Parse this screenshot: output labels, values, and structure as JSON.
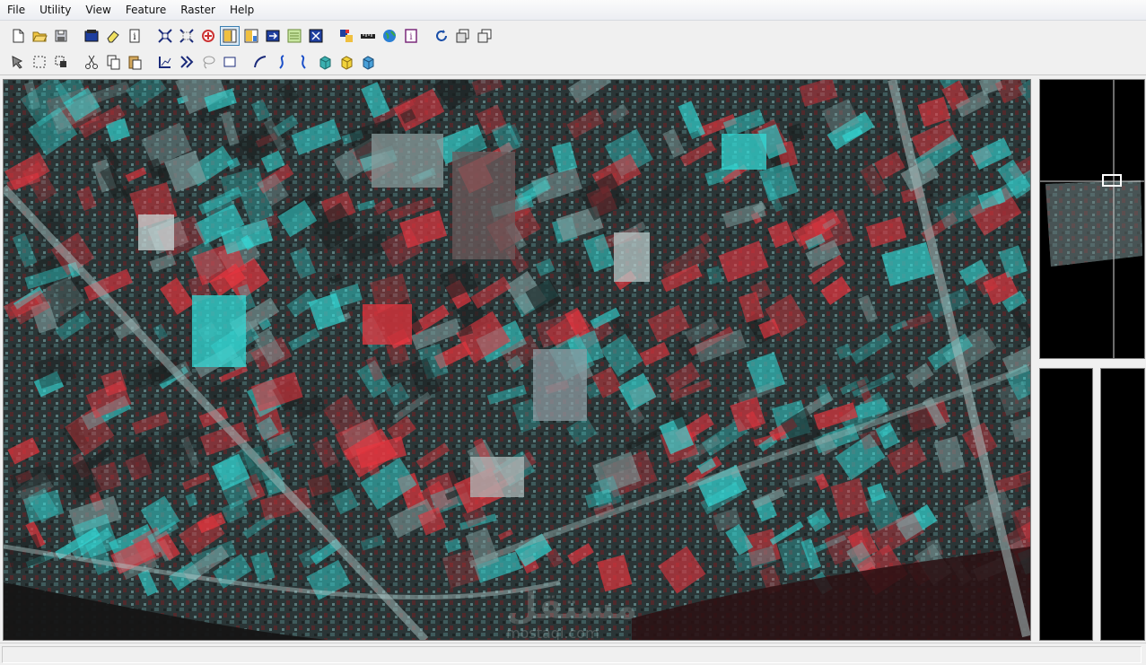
{
  "menu": [
    "File",
    "Utility",
    "View",
    "Feature",
    "Raster",
    "Help"
  ],
  "toolbar_primary": [
    {
      "icon": "new-file-icon"
    },
    {
      "icon": "open-folder-icon"
    },
    {
      "icon": "save-icon"
    },
    {
      "gap": true
    },
    {
      "icon": "viewer-icon"
    },
    {
      "icon": "eraser-icon"
    },
    {
      "icon": "info-icon"
    },
    {
      "gap": true
    },
    {
      "icon": "zoom-in-icon"
    },
    {
      "icon": "zoom-out-icon"
    },
    {
      "icon": "roam-icon"
    },
    {
      "icon": "layout-one-icon",
      "active": true
    },
    {
      "icon": "layout-two-icon"
    },
    {
      "icon": "blend-icon"
    },
    {
      "icon": "swipe-icon"
    },
    {
      "icon": "fit-window-icon"
    },
    {
      "gap": true
    },
    {
      "icon": "color-squares-icon"
    },
    {
      "icon": "ruler-icon"
    },
    {
      "icon": "globe-icon"
    },
    {
      "icon": "properties-icon"
    },
    {
      "gap": true
    },
    {
      "icon": "rotate-icon"
    },
    {
      "icon": "copy-window-icon"
    },
    {
      "icon": "tile-windows-icon"
    }
  ],
  "toolbar_secondary": [
    {
      "icon": "select-tool-icon"
    },
    {
      "icon": "marquee-icon"
    },
    {
      "icon": "box-select-icon"
    },
    {
      "gap": true
    },
    {
      "icon": "cut-icon"
    },
    {
      "icon": "copy-icon"
    },
    {
      "icon": "paste-icon"
    },
    {
      "gap": true
    },
    {
      "icon": "polyline-icon"
    },
    {
      "icon": "parallel-line-icon"
    },
    {
      "icon": "lasso-icon"
    },
    {
      "icon": "rectangle-icon"
    },
    {
      "gap": true
    },
    {
      "icon": "curve-icon"
    },
    {
      "icon": "spline-icon"
    },
    {
      "icon": "spline-alt-icon"
    },
    {
      "icon": "cube-teal-icon"
    },
    {
      "icon": "cube-yellow-icon"
    },
    {
      "icon": "cube-blue-icon"
    }
  ],
  "colors": {
    "anaglyph_red": "#e8353f",
    "anaglyph_cyan": "#33d9d6",
    "background_dark": "#121212",
    "toolbar_bg": "#f0f0f0",
    "active_border": "#3c7fb1"
  },
  "watermark": {
    "text_latin": "mostaql.com"
  }
}
